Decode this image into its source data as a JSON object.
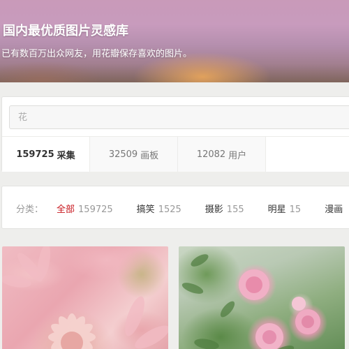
{
  "hero": {
    "title": "国内最优质图片灵感库",
    "subtitle": "已有数百万出众网友，用花瓣保存喜欢的图片。"
  },
  "search": {
    "value": "",
    "placeholder": "花"
  },
  "result_tabs": [
    {
      "count": "159725",
      "label": "采集",
      "active": true
    },
    {
      "count": "32509",
      "label": "画板",
      "active": false
    },
    {
      "count": "12082",
      "label": "用户",
      "active": false
    }
  ],
  "categories": {
    "prefix": "分类：",
    "items": [
      {
        "name": "全部",
        "count": "159725",
        "active": true
      },
      {
        "name": "搞笑",
        "count": "1525",
        "active": false
      },
      {
        "name": "摄影",
        "count": "155",
        "active": false
      },
      {
        "name": "明星",
        "count": "15",
        "active": false
      },
      {
        "name": "漫画",
        "count": "",
        "active": false
      }
    ]
  },
  "colors": {
    "accent_red": "#c8161d",
    "page_background": "#eeeeec"
  }
}
